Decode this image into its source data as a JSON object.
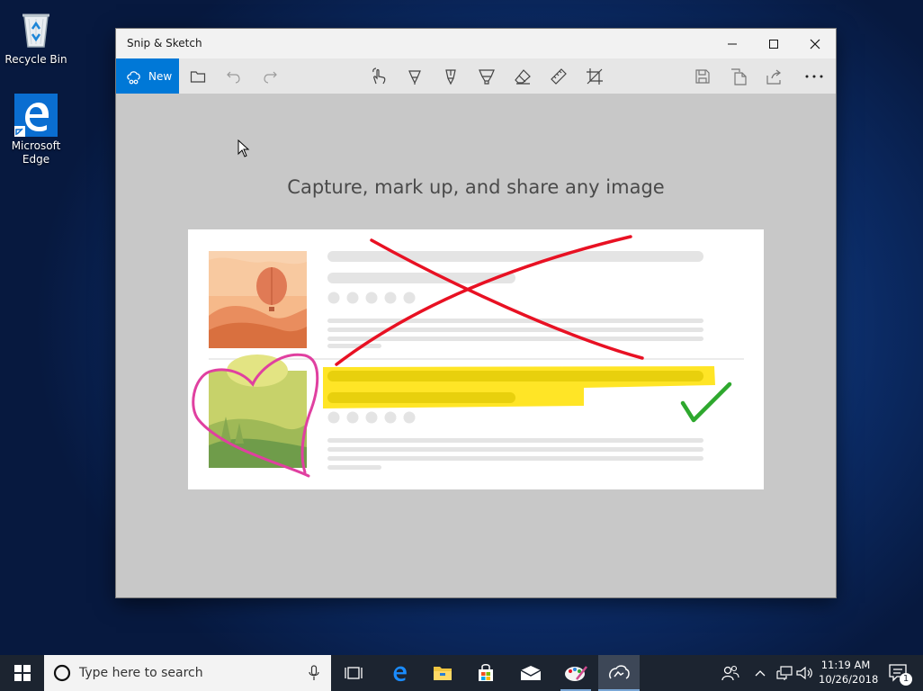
{
  "desktop": {
    "icons": [
      {
        "label": "Recycle Bin",
        "icon": "recycle-bin-icon"
      },
      {
        "label": "Microsoft Edge",
        "icon": "edge-icon"
      }
    ]
  },
  "window": {
    "title": "Snip & Sketch",
    "controls": [
      "minimize-icon",
      "maximize-icon",
      "close-icon"
    ]
  },
  "toolbar": {
    "new_label": "New",
    "tools": [
      "open-folder-icon",
      "undo-icon",
      "redo-icon",
      "touch-writing-icon",
      "ballpoint-pen-icon",
      "pencil-icon",
      "highlighter-icon",
      "eraser-icon",
      "ruler-icon",
      "crop-icon",
      "save-icon",
      "copy-icon",
      "share-icon",
      "more-icon"
    ]
  },
  "canvas": {
    "tagline": "Capture, mark up, and share any image"
  },
  "colors": {
    "accent": "#0078d7",
    "ink_red": "#e81123",
    "ink_pink": "#e040a0",
    "ink_green": "#2ea82e",
    "highlighter": "#ffe100"
  },
  "taskbar": {
    "search_placeholder": "Type here to search",
    "pinned": [
      "task-view-icon",
      "edge-icon",
      "file-explorer-icon",
      "store-icon",
      "mail-icon",
      "paint-icon",
      "snip-sketch-icon"
    ],
    "clock": {
      "time": "11:19 AM",
      "date": "10/26/2018"
    },
    "notification_count": "1"
  }
}
